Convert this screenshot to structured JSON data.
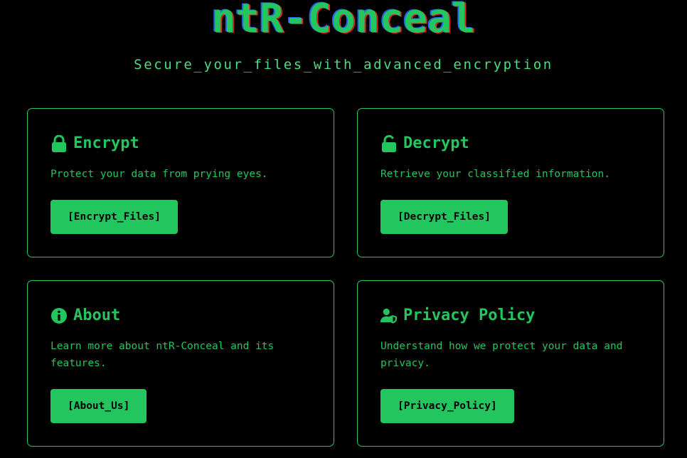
{
  "header": {
    "title": "ntR-Conceal",
    "subtitle": "Secure_your_files_with_advanced_encryption"
  },
  "cards": [
    {
      "icon": "lock-icon",
      "title": "Encrypt",
      "description": "Protect your data from prying eyes.",
      "button": "[Encrypt_Files]"
    },
    {
      "icon": "unlock-icon",
      "title": "Decrypt",
      "description": "Retrieve your classified information.",
      "button": "[Decrypt_Files]"
    },
    {
      "icon": "info-icon",
      "title": "About",
      "description": "Learn more about ntR-Conceal and its features.",
      "button": "[About_Us]"
    },
    {
      "icon": "user-shield-icon",
      "title": "Privacy Policy",
      "description": "Understand how we protect your data and privacy.",
      "button": "[Privacy_Policy]"
    }
  ],
  "colors": {
    "background": "#000000",
    "accent": "#22c55e",
    "title_shadow_blue": "#2563eb",
    "title_shadow_red": "#dc2626"
  }
}
